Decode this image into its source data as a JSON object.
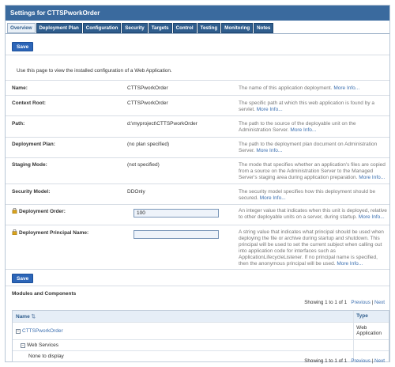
{
  "window": {
    "title": "Settings for CTTSPworkOrder"
  },
  "tabs": [
    {
      "label": "Overview",
      "active": true
    },
    {
      "label": "Deployment Plan"
    },
    {
      "label": "Configuration"
    },
    {
      "label": "Security"
    },
    {
      "label": "Targets"
    },
    {
      "label": "Control"
    },
    {
      "label": "Testing"
    },
    {
      "label": "Monitoring"
    },
    {
      "label": "Notes"
    }
  ],
  "buttons": {
    "save_top": "Save",
    "save_bottom": "Save"
  },
  "intro": "Use this page to view the installed configuration of a Web Application.",
  "more_label": "More Info...",
  "fields": {
    "name": {
      "label": "Name:",
      "value": "CTTSPworkOrder",
      "desc": "The name of this application deployment."
    },
    "context_root": {
      "label": "Context Root:",
      "value": "CTTSPworkOrder",
      "desc": "The specific path at which this web application is found by a servlet."
    },
    "path": {
      "label": "Path:",
      "value": "d:\\myproject\\CTTSPworkOrder",
      "desc": "The path to the source of the deployable unit on the Administration Server."
    },
    "deployment_plan": {
      "label": "Deployment Plan:",
      "value": "(no plan specified)",
      "desc": "The path to the deployment plan document on Administration Server."
    },
    "staging_mode": {
      "label": "Staging Mode:",
      "value": "(not specified)",
      "desc": "The mode that specifies whether an application's files are copied from a source on the Administration Server to the Managed Server's staging area during application preparation."
    },
    "security_model": {
      "label": "Security Model:",
      "value": "DDOnly",
      "desc": "The security model specifies how this deployment should be secured."
    },
    "deployment_order": {
      "label": "Deployment Order:",
      "value": "100",
      "desc": "An integer value that indicates when this unit is deployed, relative to other deployable units on a server, during startup."
    },
    "deployment_principal": {
      "label": "Deployment Principal Name:",
      "value": "",
      "desc": "A string value that indicates what principal should be used when deploying the file or archive during startup and shutdown. This principal will be used to set the current subject when calling out into application code for interfaces such as ApplicationLifecycleListener. If no principal name is specified, then the anonymous principal will be used."
    }
  },
  "modules": {
    "title": "Modules and Components",
    "pager": {
      "showing": "Showing 1 to 1 of 1",
      "previous": "Previous",
      "sep": "|",
      "next": "Next"
    },
    "columns": {
      "name": "Name",
      "type": "Type"
    },
    "rows": [
      {
        "name": "CTTSPworkOrder",
        "type": "Web Application"
      },
      {
        "name": "Web Services",
        "type": ""
      },
      {
        "name": "None to display",
        "type": ""
      }
    ]
  }
}
